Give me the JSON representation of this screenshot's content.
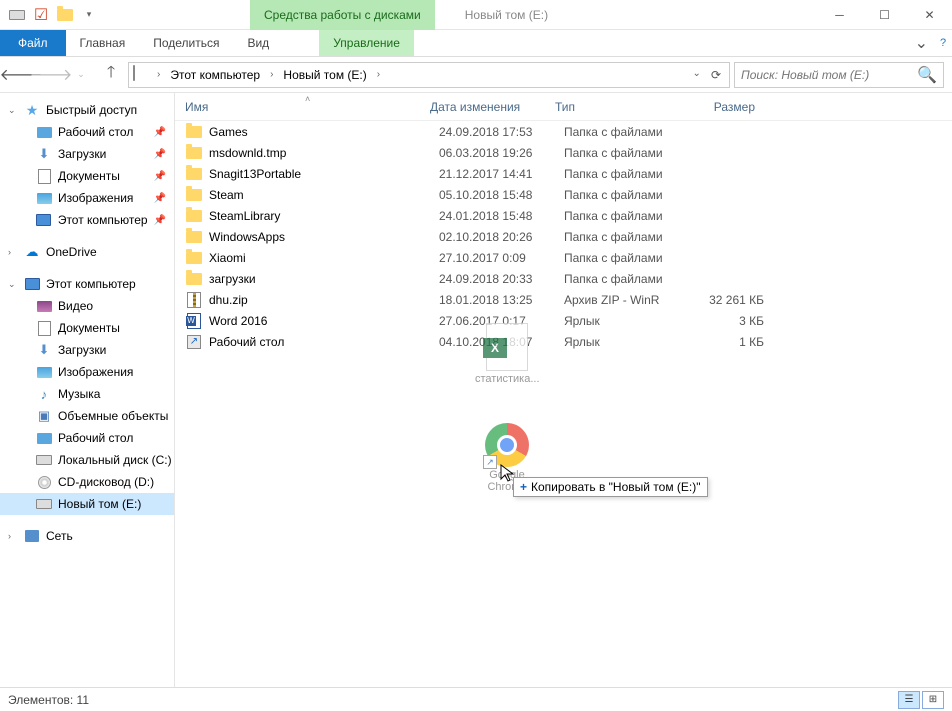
{
  "title": "Новый том (E:)",
  "context_tab": "Средства работы с дисками",
  "ribbon": {
    "file": "Файл",
    "tabs": [
      "Главная",
      "Поделиться",
      "Вид"
    ],
    "context_tab": "Управление"
  },
  "breadcrumb": {
    "segments": [
      "Этот компьютер",
      "Новый том (E:)"
    ]
  },
  "search": {
    "placeholder": "Поиск: Новый том (E:)"
  },
  "columns": {
    "name": "Имя",
    "date": "Дата изменения",
    "type": "Тип",
    "size": "Размер"
  },
  "sidebar": {
    "quick_access": "Быстрый доступ",
    "quick_items": [
      {
        "label": "Рабочий стол",
        "icon": "desktop",
        "pinned": true
      },
      {
        "label": "Загрузки",
        "icon": "downloads",
        "pinned": true
      },
      {
        "label": "Документы",
        "icon": "documents",
        "pinned": true
      },
      {
        "label": "Изображения",
        "icon": "pictures",
        "pinned": true
      },
      {
        "label": "Этот компьютер",
        "icon": "pc",
        "pinned": true
      }
    ],
    "onedrive": "OneDrive",
    "this_pc": "Этот компьютер",
    "pc_items": [
      {
        "label": "Видео",
        "icon": "video"
      },
      {
        "label": "Документы",
        "icon": "documents"
      },
      {
        "label": "Загрузки",
        "icon": "downloads"
      },
      {
        "label": "Изображения",
        "icon": "pictures"
      },
      {
        "label": "Музыка",
        "icon": "music"
      },
      {
        "label": "Объемные объекты",
        "icon": "3d"
      },
      {
        "label": "Рабочий стол",
        "icon": "desktop"
      },
      {
        "label": "Локальный диск (C:)",
        "icon": "drive"
      },
      {
        "label": "CD-дисковод (D:)",
        "icon": "cd"
      },
      {
        "label": "Новый том (E:)",
        "icon": "drive",
        "selected": true
      }
    ],
    "network": "Сеть"
  },
  "files": [
    {
      "name": "Games",
      "date": "24.09.2018 17:53",
      "type": "Папка с файлами",
      "size": "",
      "icon": "folder"
    },
    {
      "name": "msdownld.tmp",
      "date": "06.03.2018 19:26",
      "type": "Папка с файлами",
      "size": "",
      "icon": "folder"
    },
    {
      "name": "Snagit13Portable",
      "date": "21.12.2017 14:41",
      "type": "Папка с файлами",
      "size": "",
      "icon": "folder"
    },
    {
      "name": "Steam",
      "date": "05.10.2018 15:48",
      "type": "Папка с файлами",
      "size": "",
      "icon": "folder"
    },
    {
      "name": "SteamLibrary",
      "date": "24.01.2018 15:48",
      "type": "Папка с файлами",
      "size": "",
      "icon": "folder"
    },
    {
      "name": "WindowsApps",
      "date": "02.10.2018 20:26",
      "type": "Папка с файлами",
      "size": "",
      "icon": "folder"
    },
    {
      "name": "Xiaomi",
      "date": "27.10.2017 0:09",
      "type": "Папка с файлами",
      "size": "",
      "icon": "folder"
    },
    {
      "name": "загрузки",
      "date": "24.09.2018 20:33",
      "type": "Папка с файлами",
      "size": "",
      "icon": "folder"
    },
    {
      "name": "dhu.zip",
      "date": "18.01.2018 13:25",
      "type": "Архив ZIP - WinR",
      "size": "32 261 КБ",
      "icon": "zip"
    },
    {
      "name": "Word 2016",
      "date": "27.06.2017 0:17",
      "type": "Ярлык",
      "size": "3 КБ",
      "icon": "word"
    },
    {
      "name": "Рабочий стол",
      "date": "04.10.2018 18:07",
      "type": "Ярлык",
      "size": "1 КБ",
      "icon": "link"
    }
  ],
  "drag": {
    "excel_label": "статистика...",
    "chrome_label": "Google Chrome",
    "tooltip": "Копировать в \"Новый том (E:)\""
  },
  "status": {
    "text": "Элементов: 11"
  }
}
